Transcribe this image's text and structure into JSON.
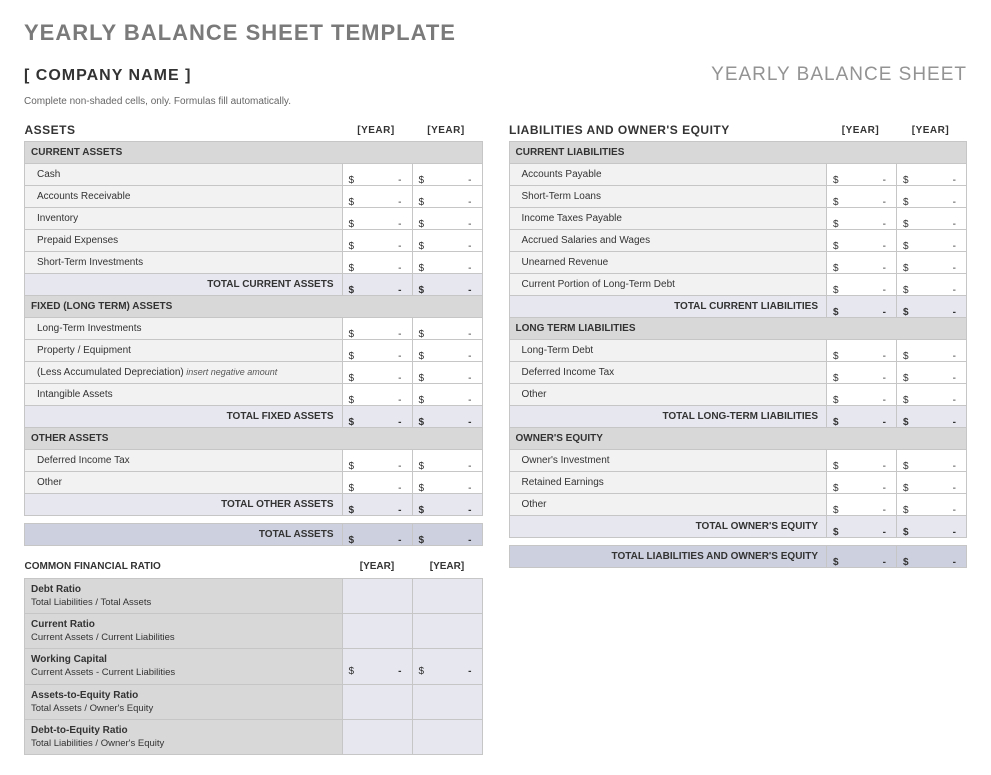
{
  "title": "YEARLY BALANCE SHEET TEMPLATE",
  "company": "[ COMPANY NAME ]",
  "sheetName": "YEARLY BALANCE SHEET",
  "instructions": "Complete non-shaded cells, only. Formulas fill automatically.",
  "yearLabel1": "[YEAR]",
  "yearLabel2": "[YEAR]",
  "currency": "$",
  "dash": "-",
  "assets": {
    "heading": "ASSETS",
    "current": {
      "header": "CURRENT ASSETS",
      "items": [
        "Cash",
        "Accounts Receivable",
        "Inventory",
        "Prepaid Expenses",
        "Short-Term Investments"
      ],
      "totalLabel": "TOTAL CURRENT ASSETS"
    },
    "fixed": {
      "header": "FIXED (LONG TERM) ASSETS",
      "items": [
        "Long-Term Investments",
        "Property / Equipment",
        "(Less Accumulated Depreciation)",
        "Intangible Assets"
      ],
      "deprHint": "insert negative amount",
      "totalLabel": "TOTAL FIXED ASSETS"
    },
    "other": {
      "header": "OTHER ASSETS",
      "items": [
        "Deferred Income Tax",
        "Other"
      ],
      "totalLabel": "TOTAL OTHER ASSETS"
    },
    "grandTotal": "TOTAL ASSETS"
  },
  "liab": {
    "heading": "LIABILITIES AND OWNER'S EQUITY",
    "current": {
      "header": "CURRENT LIABILITIES",
      "items": [
        "Accounts Payable",
        "Short-Term Loans",
        "Income Taxes Payable",
        "Accrued Salaries and Wages",
        "Unearned Revenue",
        "Current Portion of Long-Term Debt"
      ],
      "totalLabel": "TOTAL CURRENT LIABILITIES"
    },
    "longterm": {
      "header": "LONG TERM LIABILITIES",
      "items": [
        "Long-Term Debt",
        "Deferred Income Tax",
        "Other"
      ],
      "totalLabel": "TOTAL LONG-TERM LIABILITIES"
    },
    "equity": {
      "header": "OWNER'S EQUITY",
      "items": [
        "Owner's Investment",
        "Retained Earnings",
        "Other"
      ],
      "totalLabel": "TOTAL OWNER'S EQUITY"
    },
    "grandTotal": "TOTAL LIABILITIES AND OWNER'S EQUITY"
  },
  "ratios": {
    "heading": "COMMON FINANCIAL RATIO",
    "items": [
      {
        "t": "Debt Ratio",
        "d": "Total Liabilities / Total Assets",
        "money": false
      },
      {
        "t": "Current Ratio",
        "d": "Current Assets / Current Liabilities",
        "money": false
      },
      {
        "t": "Working Capital",
        "d": "Current Assets - Current Liabilities",
        "money": true
      },
      {
        "t": "Assets-to-Equity Ratio",
        "d": "Total Assets / Owner's Equity",
        "money": false
      },
      {
        "t": "Debt-to-Equity Ratio",
        "d": "Total Liabilities / Owner's Equity",
        "money": false
      }
    ]
  }
}
